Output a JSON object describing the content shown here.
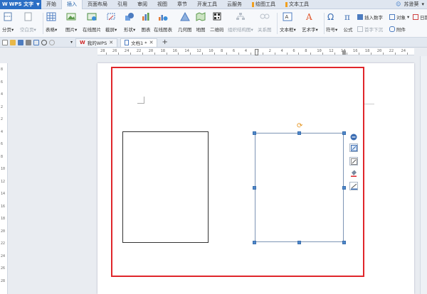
{
  "app": {
    "name": "WPS 文字"
  },
  "menu": {
    "tabs": [
      "开始",
      "插入",
      "页面布局",
      "引用",
      "审阅",
      "视图",
      "章节",
      "开发工具",
      "云服务",
      "绘图工具",
      "文本工具"
    ],
    "active": "插入",
    "user": "苏逊葵"
  },
  "ribbon": {
    "page_break": "分页",
    "blank_page": "空白页",
    "table": "表格",
    "picture": "图片",
    "online_picture": "在线图片",
    "screenshot": "截屏",
    "shape": "形状",
    "chart": "图表",
    "online_chart": "在线图表",
    "geometry": "几何图",
    "map": "地图",
    "qrcode": "二维码",
    "flowchart": "组织结构图",
    "relation": "关系图",
    "textbox": "文本框",
    "wordart": "艺术字",
    "symbol": "符号",
    "formula": "公式",
    "insert_number": "插入数字",
    "object": "对象",
    "date": "日期",
    "first_letter": "首字下沉",
    "attachment": "附件",
    "dd": "▾"
  },
  "doc_tabs": [
    {
      "label": "我的WPS"
    },
    {
      "label": "文档1 *"
    }
  ],
  "ruler": {
    "h_numbers": [
      "28",
      "26",
      "24",
      "22",
      "20",
      "18",
      "16",
      "14",
      "12",
      "10",
      "8",
      "6",
      "4",
      "2",
      "2",
      "4",
      "6",
      "8",
      "10",
      "12",
      "14",
      "16",
      "18",
      "20",
      "22",
      "24"
    ],
    "v_numbers": [
      "8",
      "6",
      "4",
      "2",
      "2",
      "4",
      "6",
      "8",
      "10",
      "12",
      "14",
      "16",
      "18",
      "20",
      "22",
      "24",
      "26",
      "28"
    ]
  },
  "colors": {
    "accent": "#2c6fc5",
    "highlight_border": "#e0262b",
    "handle": "#4f87c9",
    "rotate": "#e69520"
  }
}
